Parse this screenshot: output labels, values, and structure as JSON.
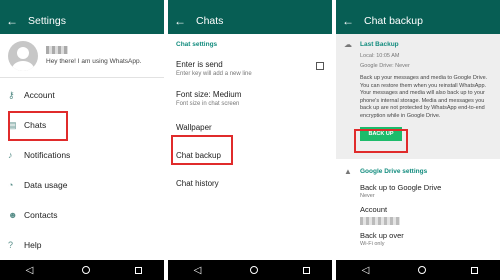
{
  "colors": {
    "primary": "#075E54",
    "accent": "#128C7E",
    "button": "#1dbb6b",
    "highlight": "#e02b2b"
  },
  "screen1": {
    "title": "Settings",
    "profile_status": "Hey there! I am using WhatsApp.",
    "items": [
      {
        "icon": "key-icon",
        "label": "Account"
      },
      {
        "icon": "chat-icon",
        "label": "Chats"
      },
      {
        "icon": "bell-icon",
        "label": "Notifications"
      },
      {
        "icon": "data-usage-icon",
        "label": "Data usage"
      },
      {
        "icon": "contacts-icon",
        "label": "Contacts"
      },
      {
        "icon": "help-icon",
        "label": "Help"
      }
    ]
  },
  "screen2": {
    "title": "Chats",
    "section": "Chat settings",
    "enter_label": "Enter is send",
    "enter_sub": "Enter key will add a new line",
    "font_label": "Font size: Medium",
    "font_sub": "Font size in chat screen",
    "wallpaper": "Wallpaper",
    "backup": "Chat backup",
    "history": "Chat history"
  },
  "screen3": {
    "title": "Chat backup",
    "last_backup_header": "Last Backup",
    "local": "Local: 10:05 AM",
    "gdrive": "Google Drive: Never",
    "description": "Back up your messages and media to Google Drive. You can restore them when you reinstall WhatsApp. Your messages and media will also back up to your phone's internal storage. Media and messages you back up are not protected by WhatsApp end-to-end encryption while in Google Drive.",
    "button": "BACK UP",
    "gd_header": "Google Drive settings",
    "backup_to": "Back up to Google Drive",
    "backup_to_value": "Never",
    "account": "Account",
    "backup_over": "Back up over",
    "backup_over_value": "Wi-Fi only"
  }
}
